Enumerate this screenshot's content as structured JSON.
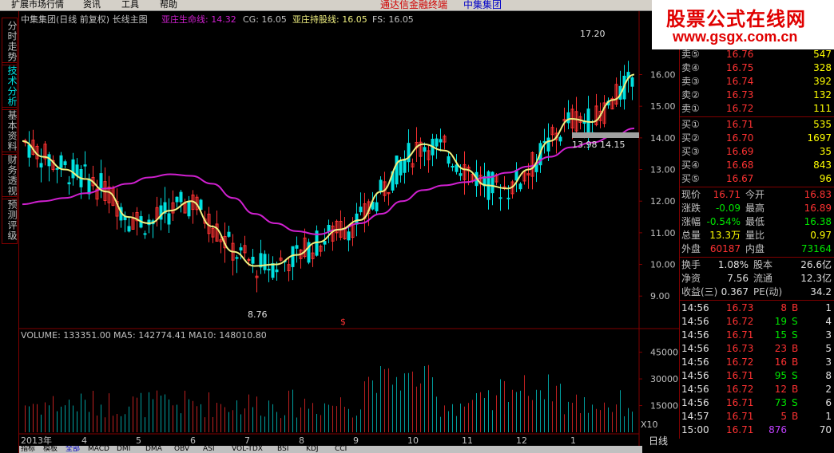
{
  "menu": [
    "扩展市场行情",
    "资讯",
    "工具",
    "帮助"
  ],
  "app_title": "通达信金融终端",
  "app_stock": "中集集团",
  "side_tabs": [
    "分时走势",
    "技术分析",
    "基本资料",
    "财务透视",
    "预测评级"
  ],
  "watermark": {
    "text": "股票公式在线网",
    "url": "www.gsgx.com.cn"
  },
  "price_header": {
    "title": "中集集团(日线 前复权) 长线主图",
    "life_label": "亚庄生命线: 14.32",
    "cg_label": "CG: 16.05",
    "hold_label": "亚庄持股线: 16.05",
    "fs_label": "FS: 16.05"
  },
  "volume_header": {
    "volume": "VOLUME: 133351.00",
    "ma5": "MA5: 142774.41",
    "ma10": "MA10: 148010.80"
  },
  "annotations": {
    "high": "17.20",
    "low": "8.76",
    "box": "13.98 14.15",
    "marker": "$",
    "vol_unit": "X10"
  },
  "x_axis": [
    "2013年",
    "4",
    "5",
    "6",
    "7",
    "8",
    "9",
    "10",
    "11",
    "12",
    "1"
  ],
  "period": "日线",
  "chart_data": {
    "type": "candlestick",
    "price_axis": {
      "ticks": [
        9.0,
        10.0,
        11.0,
        12.0,
        13.0,
        14.0,
        15.0,
        16.0
      ],
      "range": [
        8.3,
        17.5
      ]
    },
    "volume_axis": {
      "ticks": [
        15000,
        30000,
        45000
      ],
      "range": [
        0,
        52000
      ]
    },
    "series": [
      {
        "name": "亚庄生命线",
        "color": "#d020d0",
        "values": [
          11.9,
          12.0,
          12.1,
          12.25,
          12.4,
          12.55,
          12.75,
          12.85,
          12.8,
          12.55,
          12.1,
          11.6,
          11.3,
          11.05,
          10.95,
          11.1,
          11.3,
          11.6,
          12.0,
          12.35,
          12.5,
          12.6,
          12.75,
          12.9,
          13.1,
          13.4,
          13.7,
          13.85,
          14.05,
          14.3
        ]
      },
      {
        "name": "亚庄持股线",
        "color": "#f0f080",
        "values": [
          13.9,
          13.4,
          13.0,
          12.7,
          12.3,
          11.5,
          11.3,
          11.7,
          12.0,
          11.2,
          10.4,
          9.95,
          10.0,
          10.3,
          10.7,
          11.1,
          11.4,
          12.3,
          13.3,
          13.8,
          13.6,
          13.0,
          12.5,
          12.4,
          13.0,
          13.9,
          14.6,
          14.5,
          15.2,
          16.0
        ]
      }
    ]
  },
  "quote": {
    "sell": [
      {
        "label": "卖⑤",
        "price": "16.76",
        "vol": "547"
      },
      {
        "label": "卖④",
        "price": "16.75",
        "vol": "328"
      },
      {
        "label": "卖③",
        "price": "16.74",
        "vol": "392"
      },
      {
        "label": "卖②",
        "price": "16.73",
        "vol": "132"
      },
      {
        "label": "卖①",
        "price": "16.72",
        "vol": "111"
      }
    ],
    "buy": [
      {
        "label": "买①",
        "price": "16.71",
        "vol": "535"
      },
      {
        "label": "买②",
        "price": "16.70",
        "vol": "1697"
      },
      {
        "label": "买③",
        "price": "16.69",
        "vol": "35"
      },
      {
        "label": "买④",
        "price": "16.68",
        "vol": "843"
      },
      {
        "label": "买⑤",
        "price": "16.67",
        "vol": "96"
      }
    ],
    "stats": [
      {
        "l1": "现价",
        "v1": "16.71",
        "c1": "up",
        "l2": "今开",
        "v2": "16.83",
        "c2": "up"
      },
      {
        "l1": "涨跌",
        "v1": "-0.09",
        "c1": "dn",
        "l2": "最高",
        "v2": "16.89",
        "c2": "up"
      },
      {
        "l1": "涨幅",
        "v1": "-0.54%",
        "c1": "dn",
        "l2": "最低",
        "v2": "16.38",
        "c2": "dn"
      },
      {
        "l1": "总量",
        "v1": "13.3万",
        "c1": "yl",
        "l2": "量比",
        "v2": "0.97",
        "c2": "yl"
      },
      {
        "l1": "外盘",
        "v1": "60187",
        "c1": "up",
        "l2": "内盘",
        "v2": "73164",
        "c2": "dn"
      }
    ],
    "stats2": [
      {
        "l1": "换手",
        "v1": "1.08%",
        "l2": "股本",
        "v2": "26.6亿"
      },
      {
        "l1": "净资",
        "v1": "7.56",
        "l2": "流通",
        "v2": "12.3亿"
      },
      {
        "l1": "收益(三)",
        "v1": "0.367",
        "l2": "PE(动)",
        "v2": "34.2"
      }
    ],
    "ticks": [
      {
        "t": "14:56",
        "p": "16.73",
        "v": "8",
        "s": "B",
        "n": "1"
      },
      {
        "t": "14:56",
        "p": "16.72",
        "v": "19",
        "s": "S",
        "n": "4"
      },
      {
        "t": "14:56",
        "p": "16.71",
        "v": "15",
        "s": "S",
        "n": "3"
      },
      {
        "t": "14:56",
        "p": "16.73",
        "v": "23",
        "s": "B",
        "n": "5"
      },
      {
        "t": "14:56",
        "p": "16.72",
        "v": "16",
        "s": "B",
        "n": "3"
      },
      {
        "t": "14:56",
        "p": "16.71",
        "v": "95",
        "s": "S",
        "n": "8"
      },
      {
        "t": "14:56",
        "p": "16.72",
        "v": "12",
        "s": "B",
        "n": "2"
      },
      {
        "t": "14:56",
        "p": "16.71",
        "v": "73",
        "s": "S",
        "n": "6"
      },
      {
        "t": "14:57",
        "p": "16.71",
        "v": "5",
        "s": "B",
        "n": "1"
      },
      {
        "t": "15:00",
        "p": "16.71",
        "v": "876",
        "s": "",
        "n": "70"
      }
    ]
  },
  "bottom_tabs": [
    "指标",
    "模板",
    "全部",
    "MACD",
    "DMI",
    "DMA",
    "OBV",
    "ASI",
    "VOL-TDX",
    "BSI",
    "KDJ",
    "CCI"
  ]
}
